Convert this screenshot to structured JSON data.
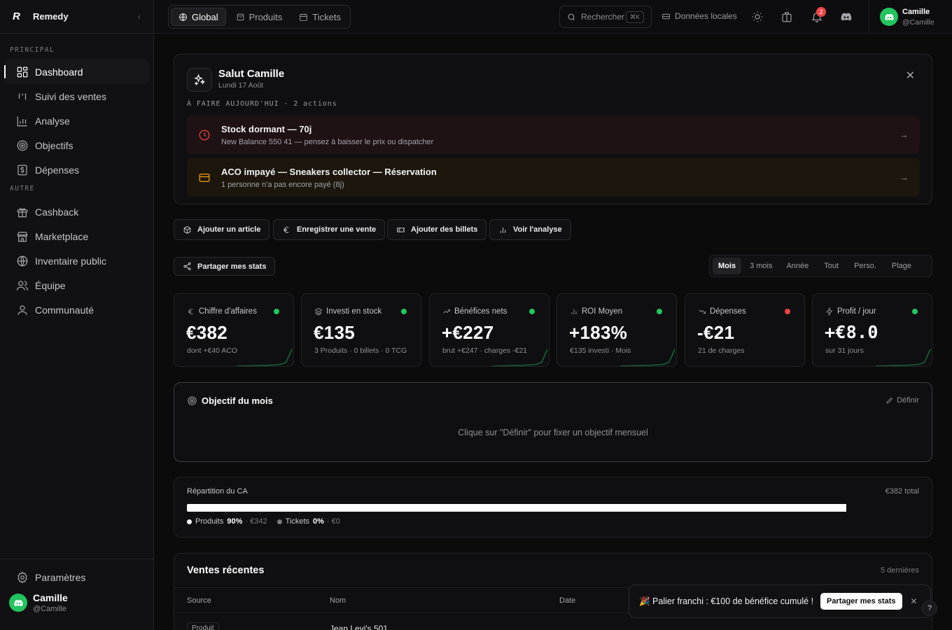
{
  "brand": {
    "logo": "R",
    "name": "Remedy",
    "collapse_icon": "chevron-left-icon"
  },
  "sidebar": {
    "section_main": "PRINCIPAL",
    "main_items": [
      {
        "label": "Dashboard",
        "icon": "grid-icon",
        "active": true
      },
      {
        "label": "Suivi des ventes",
        "icon": "bars-icon"
      },
      {
        "label": "Analyse",
        "icon": "chart-icon"
      },
      {
        "label": "Objectifs",
        "icon": "target-icon"
      },
      {
        "label": "Dépenses",
        "icon": "dollar-icon"
      }
    ],
    "section_other": "AUTRE",
    "other_items": [
      {
        "label": "Cashback",
        "icon": "gift-icon"
      },
      {
        "label": "Marketplace",
        "icon": "store-icon"
      },
      {
        "label": "Inventaire public",
        "icon": "globe-icon"
      },
      {
        "label": "Équipe",
        "icon": "users-icon"
      },
      {
        "label": "Communauté",
        "icon": "user-icon"
      }
    ],
    "settings": "Paramètres",
    "user": {
      "name": "Camille",
      "handle": "@Camille"
    }
  },
  "topbar": {
    "tabs": [
      {
        "label": "Global",
        "active": true
      },
      {
        "label": "Produits"
      },
      {
        "label": "Tickets"
      }
    ],
    "search": {
      "label": "Rechercher",
      "shortcut": "⌘K"
    },
    "local_data": "Données locales",
    "notif_count": "2",
    "user": {
      "name": "Camille",
      "handle": "@Camille"
    }
  },
  "welcome": {
    "title": "Salut Camille",
    "date": "Lundi 17 Août",
    "todo_label": "À FAIRE AUJOURD'HUI · 2 actions",
    "actions": [
      {
        "title": "Stock dormant — 70j",
        "subtitle": "New Balance 550 41 — pensez à baisser le prix ou dispatcher",
        "icon": "clock-icon",
        "color": "#ef4444"
      },
      {
        "title": "ACO impayé — Sneakers collector — Réservation",
        "subtitle": "1 personne n'a pas encore payé (8j)",
        "icon": "card-icon",
        "color": "#f59e0b"
      }
    ]
  },
  "quick_actions": [
    "Ajouter un article",
    "Enregistrer une vente",
    "Ajouter des billets",
    "Voir l'analyse"
  ],
  "share_label": "Partager mes stats",
  "periods": [
    "Mois",
    "3 mois",
    "Année",
    "Tout",
    "Perso.",
    "Plage"
  ],
  "active_period": "Mois",
  "kpis": [
    {
      "label": "Chiffre d'affaires",
      "value": "€382",
      "sub": "dont +€40 ACO",
      "icon": "euro-icon",
      "status": "#22c55e"
    },
    {
      "label": "Investi en stock",
      "value": "€135",
      "sub": "3 Produits · 0 billets · 0 TCG",
      "icon": "layers-icon",
      "status": "#22c55e"
    },
    {
      "label": "Bénéfices nets",
      "value": "+€227",
      "sub": "brut +€247 · charges -€21",
      "icon": "trend-up-icon",
      "status": "#22c55e"
    },
    {
      "label": "ROI Moyen",
      "value": "+183%",
      "sub": "€135 investi · Mois",
      "icon": "bars-icon",
      "status": "#22c55e"
    },
    {
      "label": "Dépenses",
      "value": "-€21",
      "sub": "21 de charges",
      "icon": "trend-down-icon",
      "status": "#ef4444"
    },
    {
      "label": "Profit / jour",
      "value": "+€8.0",
      "sub": "sur 31 jours",
      "icon": "bolt-icon",
      "status": "#22c55e"
    }
  ],
  "objective": {
    "title": "Objectif du mois",
    "define": "Définir",
    "hint": "Clique sur \"Définir\" pour fixer un objectif mensuel"
  },
  "repartition": {
    "title": "Répartition du CA",
    "total": "€382 total",
    "segments": [
      {
        "name": "Produits",
        "pct": "90%",
        "amount": "· €342",
        "share": 0.9,
        "color": "#ffffff"
      },
      {
        "name": "Tickets",
        "pct": "0%",
        "amount": "· €0",
        "share": 0,
        "color": "#7a7a82"
      }
    ]
  },
  "sales": {
    "title": "Ventes récentes",
    "count": "5 dernières",
    "columns": [
      "Source",
      "Nom",
      "Date"
    ],
    "first_row": {
      "source": "Produit",
      "name": "Jean Levi's 501"
    }
  },
  "toast": {
    "text": "🎉 Palier franchi : €100 de bénéfice cumulé !",
    "button": "Partager mes stats",
    "help": "?"
  }
}
